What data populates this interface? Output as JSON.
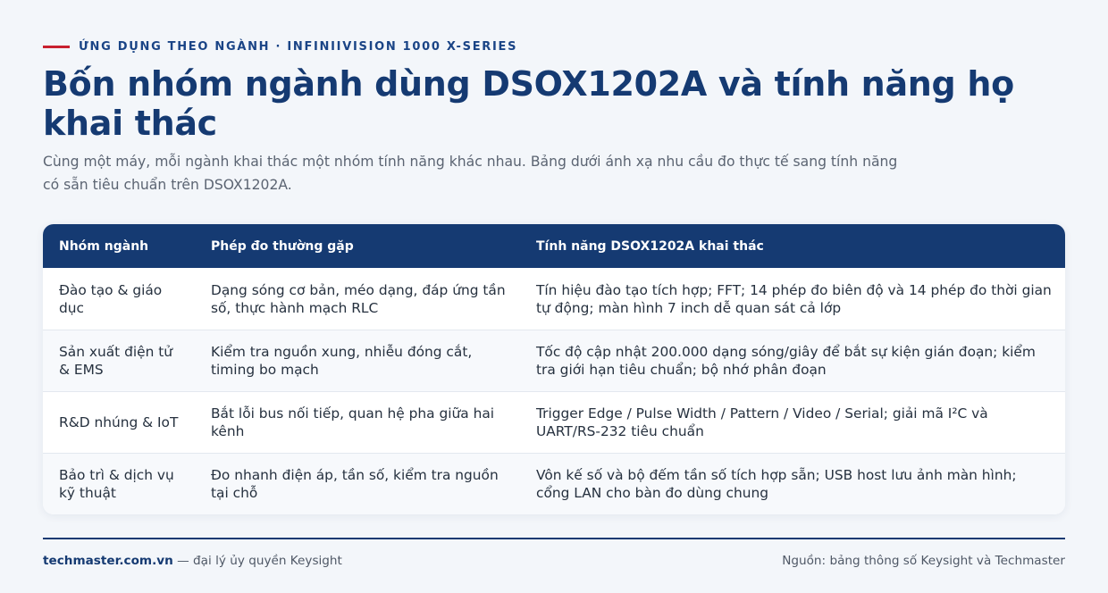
{
  "header": {
    "eyebrow": "ỨNG DỤNG THEO NGÀNH · INFINIIVISION 1000 X-SERIES",
    "title": "Bốn nhóm ngành dùng DSOX1202A và tính năng họ khai thác",
    "subtitle": "Cùng một máy, mỗi ngành khai thác một nhóm tính năng khác nhau. Bảng dưới ánh xạ nhu cầu đo thực tế sang tính năng có sẵn tiêu chuẩn trên DSOX1202A."
  },
  "table": {
    "columns": [
      "Nhóm ngành",
      "Phép đo thường gặp",
      "Tính năng DSOX1202A khai thác"
    ],
    "rows": [
      [
        "Đào tạo & giáo dục",
        "Dạng sóng cơ bản, méo dạng, đáp ứng tần số, thực hành mạch RLC",
        "Tín hiệu đào tạo tích hợp; FFT; 14 phép đo biên độ và 14 phép đo thời gian tự động; màn hình 7 inch dễ quan sát cả lớp"
      ],
      [
        "Sản xuất điện tử & EMS",
        "Kiểm tra nguồn xung, nhiễu đóng cắt, timing bo mạch",
        "Tốc độ cập nhật 200.000 dạng sóng/giây để bắt sự kiện gián đoạn; kiểm tra giới hạn tiêu chuẩn; bộ nhớ phân đoạn"
      ],
      [
        "R&D nhúng & IoT",
        "Bắt lỗi bus nối tiếp, quan hệ pha giữa hai kênh",
        "Trigger Edge / Pulse Width / Pattern / Video / Serial; giải mã I²C và UART/RS-232 tiêu chuẩn"
      ],
      [
        "Bảo trì & dịch vụ kỹ thuật",
        "Đo nhanh điện áp, tần số, kiểm tra nguồn tại chỗ",
        "Vôn kế số và bộ đếm tần số tích hợp sẵn; USB host lưu ảnh màn hình; cổng LAN cho bàn đo dùng chung"
      ]
    ]
  },
  "footer": {
    "brand": "techmaster.com.vn",
    "brand_suffix": " — đại lý ủy quyền Keysight",
    "source": "Nguồn: bảng thông số Keysight và Techmaster"
  },
  "colors": {
    "accent": "#c8202f",
    "primary": "#153a72",
    "background": "#f3f6fa"
  }
}
